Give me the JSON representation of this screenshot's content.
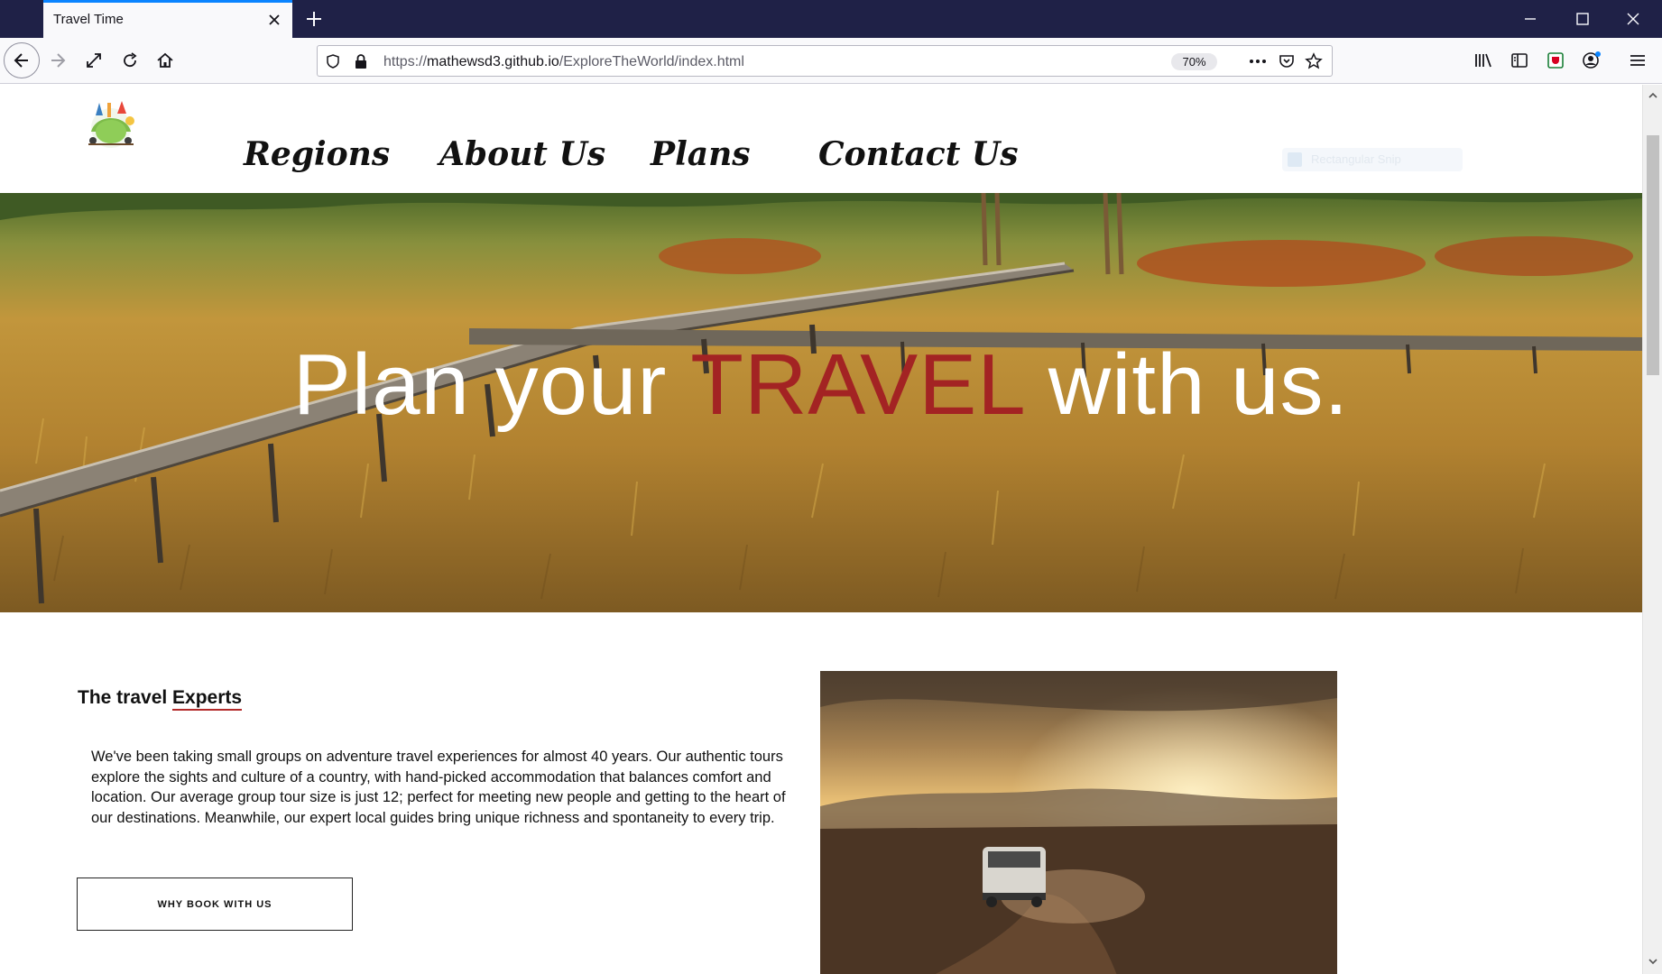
{
  "browser": {
    "tab_title": "Travel Time",
    "url_prefix": "https://",
    "url_domain": "mathewsd3.github.io",
    "url_path": "/ExploreTheWorld/index.html",
    "zoom": "70%"
  },
  "site": {
    "nav": [
      {
        "label": "Regions"
      },
      {
        "label": "About Us"
      },
      {
        "label": "Plans"
      },
      {
        "label": "Contact Us"
      }
    ],
    "faint_chip_text": "Rectangular Snip",
    "hero": {
      "title_before": "Plan your ",
      "title_accent": "TRAVEL",
      "title_after": " with us."
    },
    "intro": {
      "title_plain": "The travel ",
      "title_underlined": "Experts",
      "body": "We've been taking small groups on adventure travel experiences for almost 40 years. Our authentic tours explore the sights and culture of a country, with hand-picked accommodation that balances comfort and location. Our average group tour size is just 12; perfect for meeting new people and getting to the heart of our destinations. Meanwhile, our expert local guides bring unique richness and spontaneity to every trip.",
      "button_label": "WHY BOOK WITH US"
    }
  },
  "colors": {
    "tabbar": "#1f2147",
    "accent_tab": "#0a84ff",
    "hero_accent": "#a32323",
    "underline": "#b32a2a"
  },
  "icons": [
    "close-icon",
    "plus-icon",
    "back-icon",
    "forward-icon",
    "fullscreen-icon",
    "reload-icon",
    "home-icon",
    "shield-icon",
    "lock-icon",
    "more-icon",
    "pocket-icon",
    "star-icon",
    "library-icon",
    "sidebar-icon",
    "extension-icon",
    "account-icon",
    "menu-icon"
  ]
}
